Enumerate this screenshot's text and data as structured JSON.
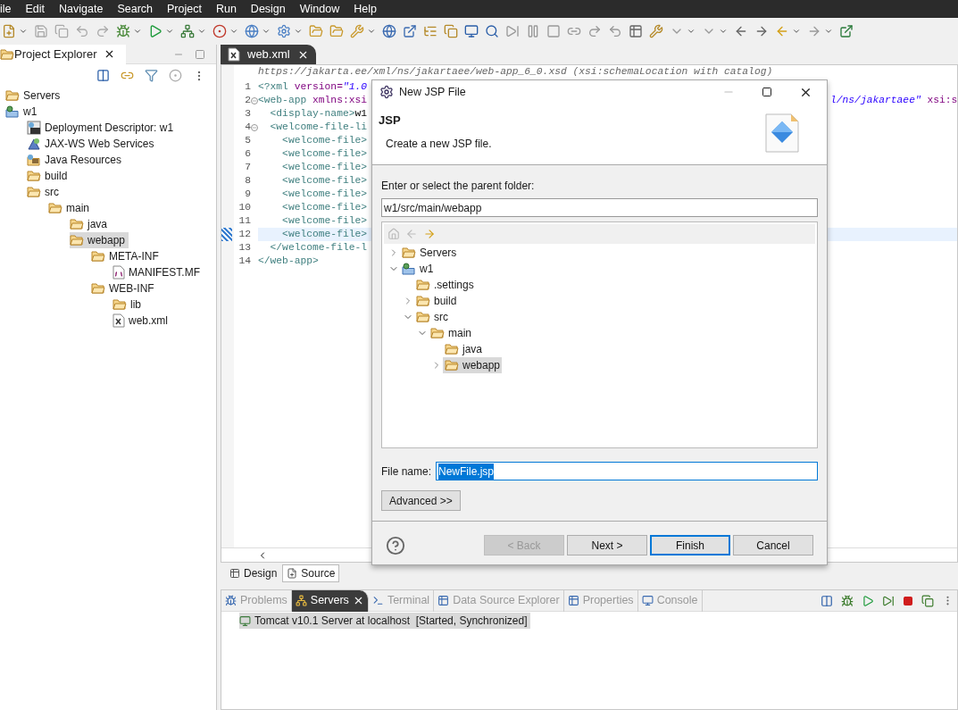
{
  "menu": [
    "ile",
    "Edit",
    "Navigate",
    "Search",
    "Project",
    "Run",
    "Design",
    "Window",
    "Help"
  ],
  "project_explorer": {
    "tab": {
      "label": "Project Explorer",
      "selected": true
    },
    "tree": [
      {
        "label": "Servers",
        "kind": "servers",
        "selected": false
      },
      {
        "label": "w1",
        "kind": "project",
        "selected": false,
        "children": [
          {
            "label": "Deployment Descriptor: w1",
            "kind": "descriptor",
            "selected": false
          },
          {
            "label": "JAX-WS Web Services",
            "kind": "webservices",
            "selected": false
          },
          {
            "label": "Java Resources",
            "kind": "resources",
            "selected": false
          },
          {
            "label": "build",
            "kind": "folder",
            "selected": false
          },
          {
            "label": "src",
            "kind": "folder",
            "selected": false,
            "children": [
              {
                "label": "main",
                "kind": "folder",
                "selected": false,
                "children": [
                  {
                    "label": "java",
                    "kind": "folder",
                    "selected": false
                  },
                  {
                    "label": "webapp",
                    "kind": "folder",
                    "selected": true,
                    "children": [
                      {
                        "label": "META-INF",
                        "kind": "folder",
                        "selected": false,
                        "children": [
                          {
                            "label": "MANIFEST.MF",
                            "kind": "manifest",
                            "selected": false
                          }
                        ]
                      },
                      {
                        "label": "WEB-INF",
                        "kind": "folder",
                        "selected": false,
                        "children": [
                          {
                            "label": "lib",
                            "kind": "folder",
                            "selected": false
                          },
                          {
                            "label": "web.xml",
                            "kind": "xml",
                            "selected": false
                          }
                        ]
                      }
                    ]
                  }
                ]
              }
            ]
          }
        ]
      }
    ]
  },
  "editor": {
    "tab": {
      "label": "web.xml",
      "selected": true
    },
    "info_line": "https://jakarta.ee/xml/ns/jakartaee/web-app_6_0.xsd (xsi:schemaLocation with catalog)",
    "lines": [
      {
        "number": "1",
        "foldable": false,
        "current": false,
        "segments": [
          {
            "kind": "tag",
            "text": "<?xml"
          },
          {
            "kind": "attr",
            "text": " version="
          },
          {
            "kind": "string",
            "text": "\"1.0"
          }
        ]
      },
      {
        "number": "2",
        "foldable": true,
        "current": false,
        "segments": [
          {
            "kind": "tag",
            "text": "<web-app"
          },
          {
            "kind": "attr",
            "text": " xmlns:xsi"
          }
        ],
        "tail": [
          {
            "kind": "string",
            "text": "l/ns/jakartaee\""
          },
          {
            "kind": "attr",
            "text": " xsi:s"
          }
        ]
      },
      {
        "number": "3",
        "foldable": false,
        "current": false,
        "segments": [
          {
            "kind": "tag",
            "text": "  <display-name>"
          },
          {
            "kind": "text",
            "text": "w1"
          }
        ]
      },
      {
        "number": "4",
        "foldable": true,
        "current": false,
        "segments": [
          {
            "kind": "tag",
            "text": "  <welcome-file-li"
          }
        ]
      },
      {
        "number": "5",
        "foldable": false,
        "current": false,
        "segments": [
          {
            "kind": "tag",
            "text": "    <welcome-file>"
          }
        ]
      },
      {
        "number": "6",
        "foldable": false,
        "current": false,
        "segments": [
          {
            "kind": "tag",
            "text": "    <welcome-file>"
          }
        ]
      },
      {
        "number": "7",
        "foldable": false,
        "current": false,
        "segments": [
          {
            "kind": "tag",
            "text": "    <welcome-file>"
          }
        ]
      },
      {
        "number": "8",
        "foldable": false,
        "current": false,
        "segments": [
          {
            "kind": "tag",
            "text": "    <welcome-file>"
          }
        ]
      },
      {
        "number": "9",
        "foldable": false,
        "current": false,
        "segments": [
          {
            "kind": "tag",
            "text": "    <welcome-file>"
          }
        ]
      },
      {
        "number": "10",
        "foldable": false,
        "current": false,
        "segments": [
          {
            "kind": "tag",
            "text": "    <welcome-file>"
          }
        ]
      },
      {
        "number": "11",
        "foldable": false,
        "current": false,
        "segments": [
          {
            "kind": "tag",
            "text": "    <welcome-file>"
          }
        ]
      },
      {
        "number": "12",
        "foldable": false,
        "current": true,
        "segments": [
          {
            "kind": "tag",
            "text": "    <welcome-file>"
          }
        ]
      },
      {
        "number": "13",
        "foldable": false,
        "current": false,
        "segments": [
          {
            "kind": "tag",
            "text": "  </welcome-file-l"
          }
        ]
      },
      {
        "number": "14",
        "foldable": false,
        "current": false,
        "segments": [
          {
            "kind": "tag",
            "text": "</web-app>"
          }
        ]
      }
    ],
    "bottom_tabs": [
      {
        "label": "Design",
        "kind": "design",
        "selected": false
      },
      {
        "label": "Source",
        "kind": "source",
        "selected": true
      }
    ]
  },
  "dialog": {
    "title": "New JSP File",
    "heading": "JSP",
    "description": "Create a new JSP file.",
    "parent_label": "Enter or select the parent folder:",
    "parent_value": "w1/src/main/webapp",
    "tree": [
      {
        "label": "Servers",
        "kind": "servers",
        "expanded": false,
        "selected": false
      },
      {
        "label": "w1",
        "kind": "project",
        "expanded": true,
        "selected": false,
        "children": [
          {
            "label": ".settings",
            "kind": "folder",
            "selected": false
          },
          {
            "label": "build",
            "kind": "folder",
            "expanded": false,
            "selected": false
          },
          {
            "label": "src",
            "kind": "folder",
            "expanded": true,
            "selected": false,
            "children": [
              {
                "label": "main",
                "kind": "folder",
                "expanded": true,
                "selected": false,
                "children": [
                  {
                    "label": "java",
                    "kind": "folder",
                    "selected": false
                  },
                  {
                    "label": "webapp",
                    "kind": "folder",
                    "expanded": false,
                    "selected": true
                  }
                ]
              }
            ]
          }
        ]
      }
    ],
    "file_name_label": "File name:",
    "file_name_value": "NewFile.jsp",
    "advanced": "Advanced >>",
    "buttons": [
      {
        "label": "< Back",
        "disabled": true,
        "default": false
      },
      {
        "label": "Next >",
        "disabled": false,
        "default": false
      },
      {
        "label": "Finish",
        "disabled": false,
        "default": true
      },
      {
        "label": "Cancel",
        "disabled": false,
        "default": false
      }
    ]
  },
  "bottom_panel": {
    "tabs": [
      {
        "label": "Problems",
        "kind": "problems",
        "selected": false
      },
      {
        "label": "Servers",
        "kind": "servers",
        "selected": true
      },
      {
        "label": "Terminal",
        "kind": "terminal",
        "selected": false
      },
      {
        "label": "Data Source Explorer",
        "kind": "datasource",
        "selected": false
      },
      {
        "label": "Properties",
        "kind": "properties",
        "selected": false
      },
      {
        "label": "Console",
        "kind": "console",
        "selected": false
      }
    ],
    "rows": [
      {
        "text": "Tomcat v10.1 Server at localhost  [Started, Synchronized]",
        "selected": true
      }
    ]
  }
}
